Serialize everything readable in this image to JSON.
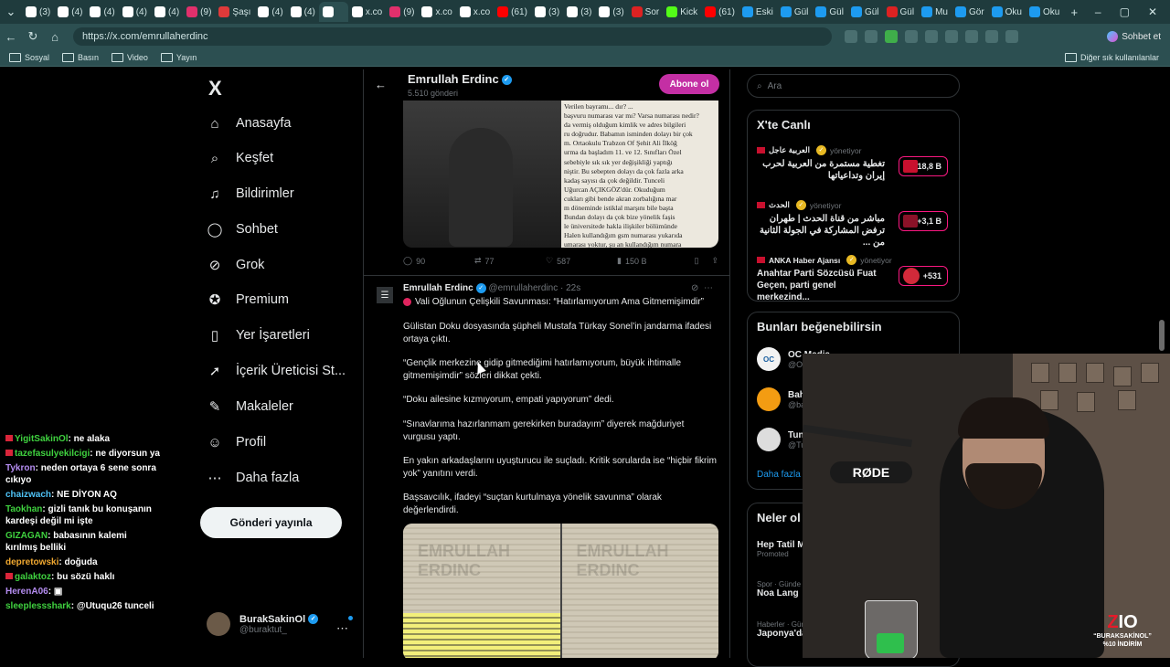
{
  "browser": {
    "tabs": [
      "(3)",
      "(4)",
      "(4)",
      "(4)",
      "(4)",
      "(9)",
      "Şaşı",
      "(4)",
      "(4)",
      "",
      "x.co",
      "(9)",
      "x.co",
      "x.co",
      "(61)",
      "(3)",
      "(3)",
      "(3)",
      "Sor",
      "Kick",
      "(61)",
      "Eski",
      "Gül",
      "Gül",
      "Gül",
      "Gül",
      "Mu",
      "Gör",
      "Oku",
      "Oku"
    ],
    "url": "https://x.com/emrullaherdinc",
    "chat_button": "Sohbet et",
    "bookmarks": [
      "Sosyal",
      "Basın",
      "Video",
      "Yayın"
    ],
    "other_bookmarks": "Diğer sık kullanılanlar"
  },
  "nav": {
    "logo": "X",
    "items": [
      {
        "label": "Anasayfa",
        "icon": "home-icon",
        "glyph": "⌂"
      },
      {
        "label": "Keşfet",
        "icon": "search-icon",
        "glyph": "⌕"
      },
      {
        "label": "Bildirimler",
        "icon": "bell-icon",
        "glyph": "♫"
      },
      {
        "label": "Sohbet",
        "icon": "chat-icon",
        "glyph": "◯"
      },
      {
        "label": "Grok",
        "icon": "grok-icon",
        "glyph": "⊘"
      },
      {
        "label": "Premium",
        "icon": "premium-icon",
        "glyph": "✪"
      },
      {
        "label": "Yer İşaretleri",
        "icon": "bookmark-icon",
        "glyph": "▯"
      },
      {
        "label": "İçerik Üreticisi St...",
        "icon": "rocket-icon",
        "glyph": "➚"
      },
      {
        "label": "Makaleler",
        "icon": "article-icon",
        "glyph": "✎"
      },
      {
        "label": "Profil",
        "icon": "profile-icon",
        "glyph": "☺"
      },
      {
        "label": "Daha fazla",
        "icon": "more-icon",
        "glyph": "⋯"
      }
    ],
    "post_button": "Gönderi yayınla",
    "account": {
      "name": "BurakSakinOl",
      "handle": "@buraktut_"
    }
  },
  "chat": [
    {
      "user": "YigitSakinOl",
      "color": "#3fd13f",
      "msg": "ne alaka",
      "heart": true
    },
    {
      "user": "tazefasulyekilcigi",
      "color": "#3fd13f",
      "msg": "ne diyorsun ya",
      "heart": true
    },
    {
      "user": "Tykron",
      "color": "#b48cf0",
      "msg": "neden ortaya 6 sene sonra cıkıyo",
      "heart": false
    },
    {
      "user": "chaizwach",
      "color": "#4fc3f7",
      "msg": "NE DİYON AQ",
      "heart": false
    },
    {
      "user": "Taokhan",
      "color": "#3fd13f",
      "msg": "gizli tanık bu konuşanın kardeşi değil mi işte",
      "heart": false
    },
    {
      "user": "GIZAGAN",
      "color": "#3fd13f",
      "msg": "babasının kalemi kırılmış belliki",
      "heart": false
    },
    {
      "user": "depretowski",
      "color": "#f0a830",
      "msg": "doğuda",
      "heart": false
    },
    {
      "user": "galaktoz",
      "color": "#3fd13f",
      "msg": "bu sözü haklı",
      "heart": true
    },
    {
      "user": "HerenA06",
      "color": "#b48cf0",
      "msg": "▣",
      "heart": false
    },
    {
      "user": "sleeplessshark",
      "color": "#3fd13f",
      "msg": "@Utuqu26 tunceli",
      "heart": false
    }
  ],
  "profile": {
    "name": "Emrullah Erdinc",
    "post_count": "5.510 gönderi",
    "subscribe": "Abone ol"
  },
  "post1": {
    "doc_lines": [
      "Verilen bayramı... dır? ...",
      "başvuru numarası var mı? Varsa numarası nedir?",
      "da vermiş olduğum kimlik ve adres bilgileri",
      "ru doğrudur. Babamın isminden dolayı bir çok",
      "m. Ortaokulu Trabzon Of Şehit Ali İlköğ",
      "urma da başladım 11. ve 12. Sınıfları Özel",
      "sebebiyle sık sık yer değişikliği yaptığı",
      "niştir. Bu sebepten dolayı da çok fazla arka",
      "kadaş sayısı da çok değildir. Tunceli",
      "Uğurcan AÇIKGÖZ'dür. Okuduğum",
      "cukları gibi bende akran zorbalığına mar",
      "m döneminde istiklal marşını bile başta",
      "Bundan dolayı da çok bize yönelik faşis",
      "le üniversitede hakla ilişkiler bölümünde",
      "Halen kullandığım gsm numarası yukarıda",
      "umarası yoktur, şu an kullandığım numara"
    ],
    "replies": "90",
    "reposts": "77",
    "likes": "587",
    "views": "150 B"
  },
  "post2": {
    "name": "Emrullah Erdinc",
    "handle": "@emrullaherdinc · 22s",
    "title": "Vali Oğlunun Çelişkili Savunması: “Hatırlamıyorum Ama Gitmemişimdir”",
    "paragraphs": [
      "Gülistan Doku dosyasında şüpheli Mustafa Türkay Sonel’in jandarma ifadesi ortaya çıktı.",
      "“Gençlik merkezine gidip gitmediğimi hatırlamıyorum, büyük ihtimalle gitmemişimdir” sözleri dikkat çekti.",
      "“Doku ailesine kızmıyorum, empati yapıyorum” dedi.",
      "“Sınavlarıma hazırlanmam gerekirken buradayım” diyerek mağduriyet vurgusu yaptı.",
      "En yakın arkadaşlarını uyuşturucu ile suçladı. Kritik sorularda ise “hiçbir fikrim yok” yanıtını verdi.",
      "Başsavcılık, ifadeyi “suçtan kurtulmaya yönelik savunma” olarak değerlendirdi."
    ],
    "watermark": "EMRULLAH ERDINC"
  },
  "right": {
    "search_placeholder": "Ara",
    "live_title": "X'te Canlı",
    "live": [
      {
        "source": "العربية عاجل",
        "managed": "yönetiyor",
        "text": "تغطية مستمرة من العربية لحرب إيران وتداعياتها",
        "count": "+18,8 B"
      },
      {
        "source": "الحدث",
        "managed": "yönetiyor",
        "text": "مباشر من قناة الحدث | طهران ترفض المشاركة في الجولة الثانية من ...",
        "count": "+3,1 B"
      },
      {
        "source": "ANKA Haber Ajansı",
        "managed": "yönetiyor",
        "text": "Anahtar Parti Sözcüsü Fuat Geçen, parti genel merkezind...",
        "count": "+531"
      }
    ],
    "suggest_title": "Bunları beğenebilirsin",
    "suggestions": [
      {
        "name": "OC Media",
        "handle": "@OC",
        "initials": "OC"
      },
      {
        "name": "Bah",
        "handle": "@ba",
        "initials": ""
      },
      {
        "name": "Tun",
        "handle": "@Tu",
        "initials": ""
      }
    ],
    "show_more": "Daha fazla",
    "trends_title": "Neler ol",
    "trends": [
      {
        "small": "",
        "big": "Hep Tatil M",
        "extra": "Promoted"
      },
      {
        "small": "Spor · Günde",
        "big": "Noa Lang",
        "extra": ""
      },
      {
        "small": "Haberler · Gündemdekiler",
        "big": "Japonya'da 7.4",
        "extra": ""
      }
    ]
  },
  "overlay": {
    "logo_main": "Z",
    "logo_rest": "IO",
    "line1": "“BURAKSAKİNOL”",
    "line2": "%10 İNDİRİM",
    "mic_brand": "RØDE"
  }
}
